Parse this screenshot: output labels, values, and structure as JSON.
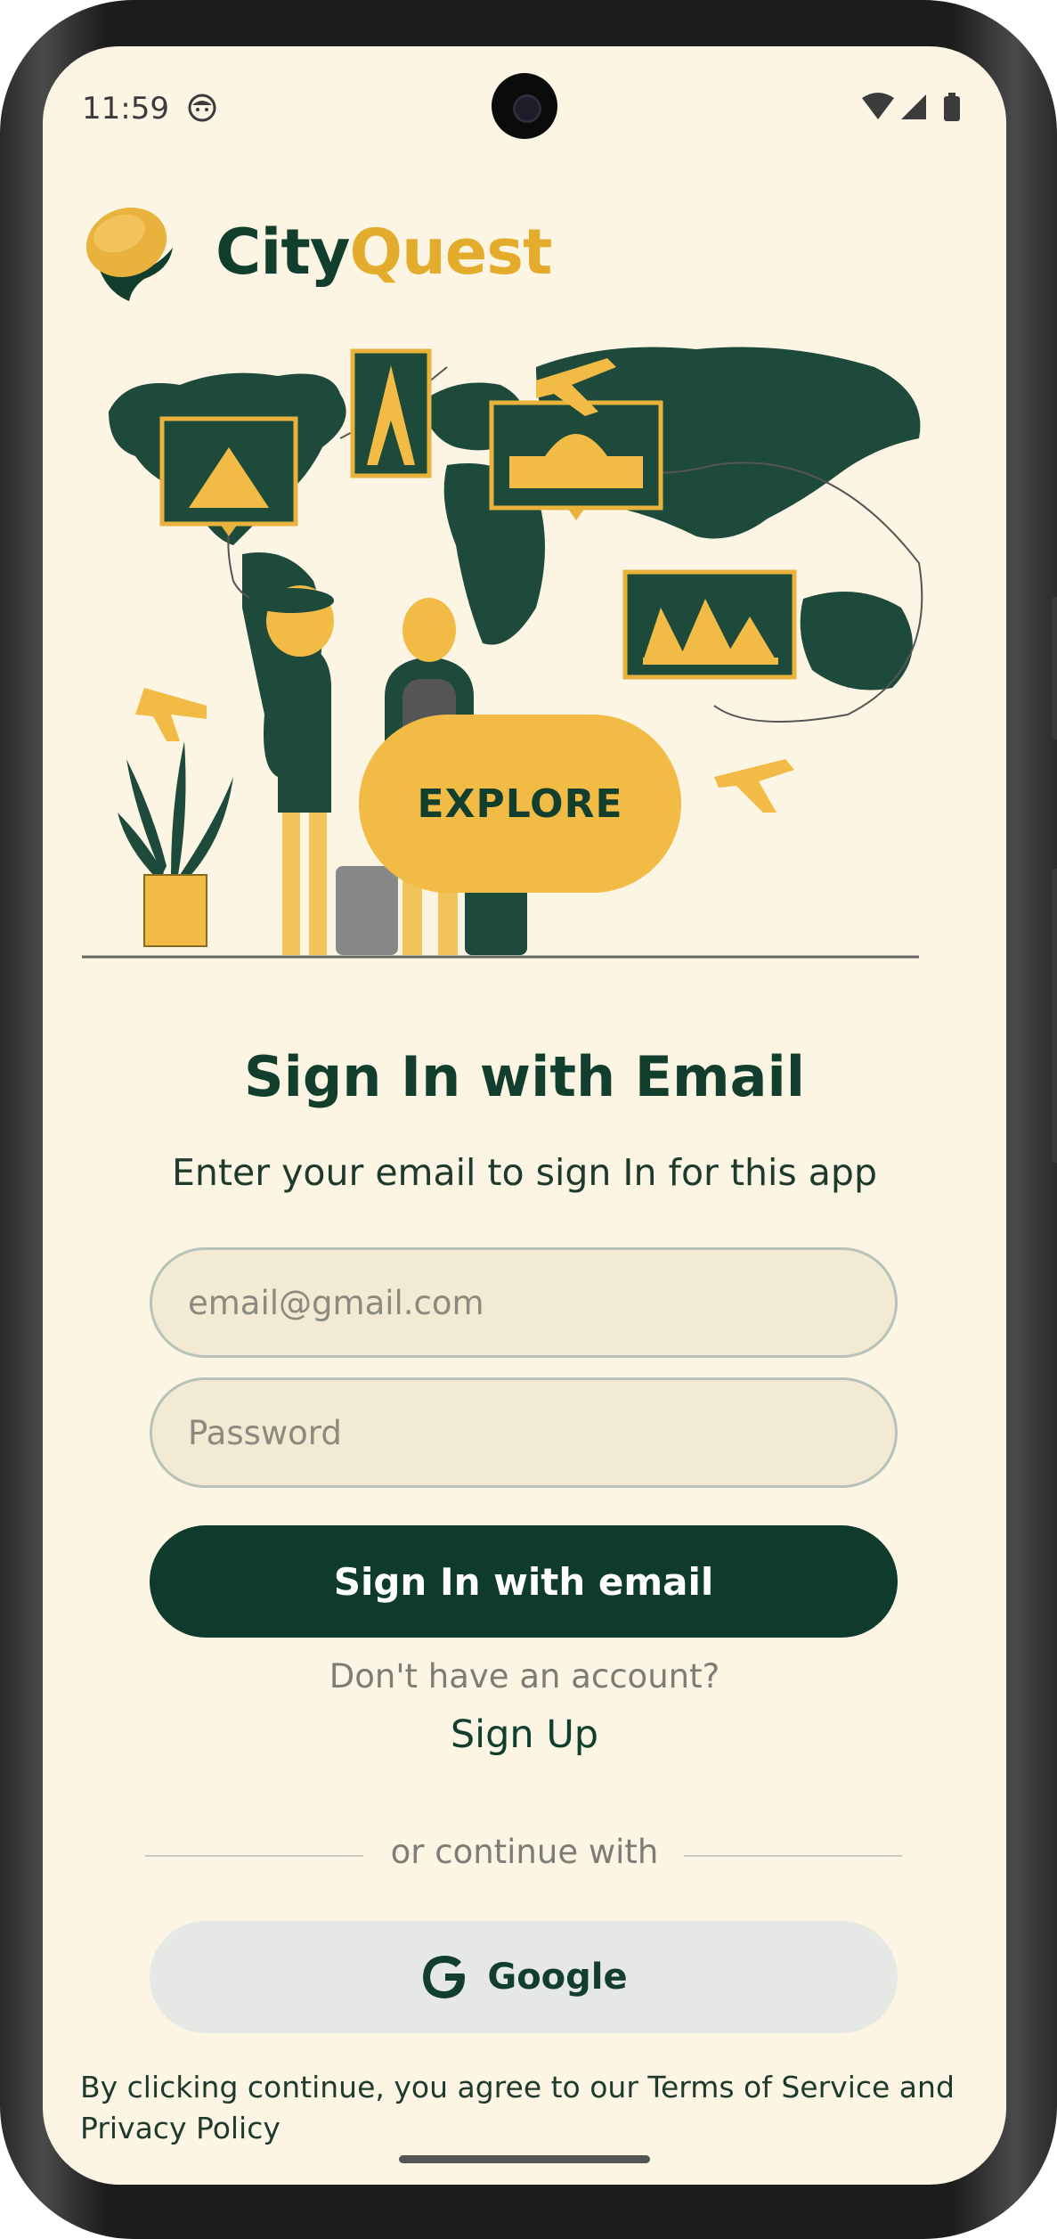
{
  "status_bar": {
    "time": "11:59"
  },
  "brand": {
    "part1": "City",
    "part2": "Quest",
    "colors": {
      "dark_green": "#123e2e",
      "gold": "#e3ac2c"
    }
  },
  "hero": {
    "explore_label": "EXPLORE"
  },
  "signin": {
    "title": "Sign In with Email",
    "subtitle": "Enter your email to sign In for this app",
    "email_placeholder": "email@gmail.com",
    "password_placeholder": "Password",
    "submit_label": "Sign In with email",
    "no_account_text": "Don't have an account?",
    "signup_link": "Sign Up",
    "divider_text": "or continue with",
    "google_label": "Google"
  },
  "footer": {
    "terms_text": "By clicking continue, you agree to our Terms of Service and Privacy Policy"
  },
  "theme": {
    "background": "#fcf5e4",
    "primary": "#0e3b2c",
    "accent": "#f2bb45",
    "input_bg": "#f3ead3",
    "google_bg": "#e6e8e5"
  }
}
